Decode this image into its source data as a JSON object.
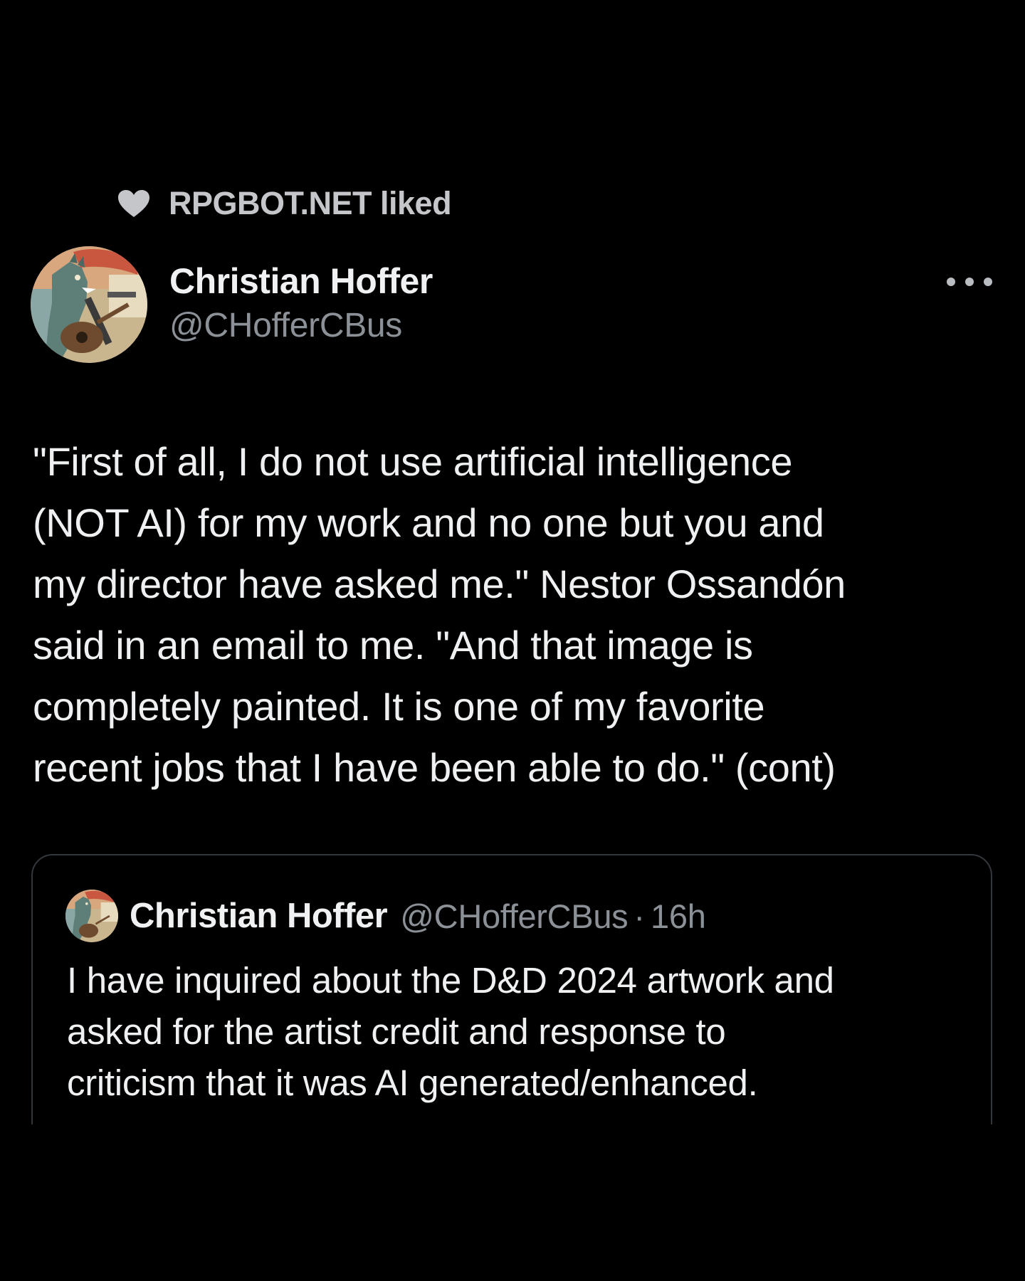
{
  "social_context": {
    "icon": "heart-icon",
    "text": "RPGBOT.NET liked"
  },
  "author": {
    "name": "Christian Hoffer",
    "handle": "@CHofferCBus"
  },
  "more_icon": "more-horizontal-icon",
  "tweet": {
    "lines": [
      "\"First of all, I do not use artificial intelligence",
      "(NOT AI) for my work and no one but you and",
      "my director have asked me.\" Nestor Ossandón",
      "said in an email to me. \"And that image is",
      "completely painted. It is one of my favorite",
      "recent jobs that I have been able to do.\" (cont)"
    ]
  },
  "quoted_tweet": {
    "name": "Christian Hoffer",
    "handle": "@CHofferCBus",
    "separator": "·",
    "time": "16h",
    "lines": [
      "I have inquired about the D&D 2024 artwork and",
      "asked for the artist credit and response to",
      "criticism that it was AI generated/enhanced."
    ]
  },
  "colors": {
    "background": "#000000",
    "primary_text": "#eef0f1",
    "secondary_text": "#8b9197",
    "border": "#33373b"
  }
}
